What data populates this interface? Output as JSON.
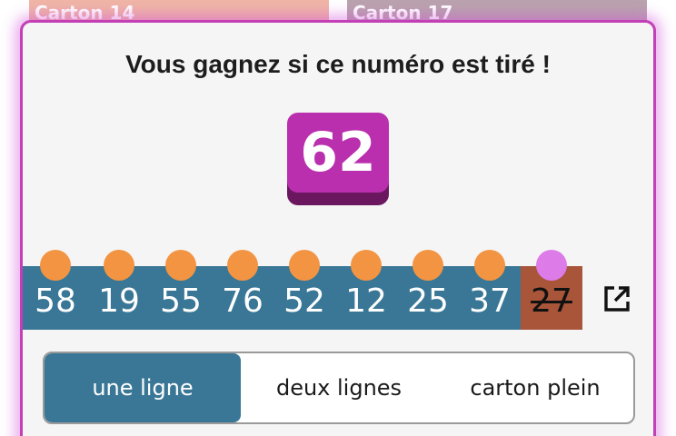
{
  "background_cards": [
    {
      "label": "Carton 14",
      "color": "#efb5a6"
    },
    {
      "label": "Carton 17",
      "color": "#b9a3ad"
    }
  ],
  "modal": {
    "title": "Vous gagnez si ce numéro est tiré !",
    "winning_number": "62",
    "border_color": "#c23fb6"
  },
  "numbers": [
    {
      "value": "58",
      "marked": true
    },
    {
      "value": "19",
      "marked": true
    },
    {
      "value": "55",
      "marked": true
    },
    {
      "value": "76",
      "marked": true
    },
    {
      "value": "52",
      "marked": true
    },
    {
      "value": "12",
      "marked": true
    },
    {
      "value": "25",
      "marked": true
    },
    {
      "value": "37",
      "marked": true
    },
    {
      "value": "27",
      "marked": true,
      "crossed": true
    }
  ],
  "icons": {
    "open": "open-in-new-icon"
  },
  "modes": [
    {
      "label": "une ligne",
      "active": true
    },
    {
      "label": "deux lignes",
      "active": false
    },
    {
      "label": "carton plein",
      "active": false
    }
  ],
  "colors": {
    "accent": "#b92fad",
    "row": "#3a7796",
    "row_last": "#a8553a",
    "dot": "#f39442",
    "dot_last": "#dd7be8"
  }
}
